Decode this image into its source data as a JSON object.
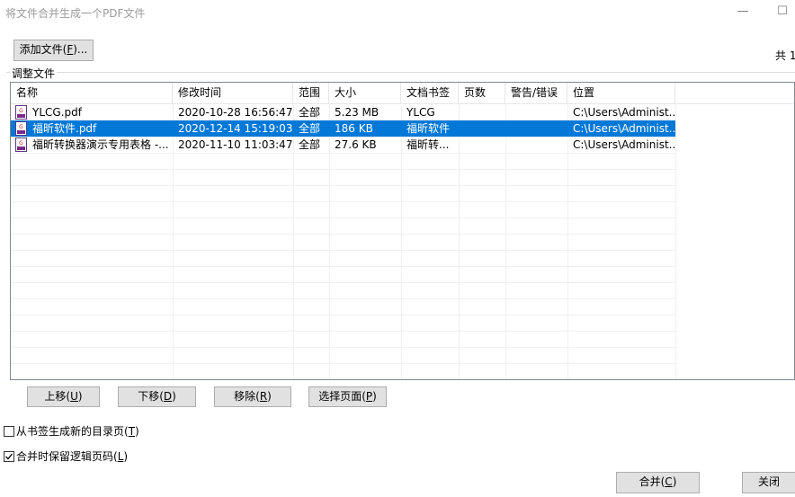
{
  "window": {
    "title": "将文件合并生成一个PDF文件",
    "minimize_glyph": "—",
    "maximize_glyph": "☐"
  },
  "toolbar": {
    "add_files_label": "添加文件(",
    "add_files_key": "F",
    "add_files_tail": ")...",
    "total_label": "共 1"
  },
  "group": {
    "label": "调整文件"
  },
  "table": {
    "columns": [
      "名称",
      "修改时间",
      "范围",
      "大小",
      "文档书签",
      "页数",
      "警告/错误",
      "位置"
    ],
    "rows": [
      {
        "name": "YLCG.pdf",
        "modified": "2020-10-28 16:56:47",
        "range": "全部",
        "size": "5.23 MB",
        "bookmark": "YLCG",
        "pages": "",
        "warning": "",
        "location": "C:\\Users\\Administ...",
        "selected": false
      },
      {
        "name": "福昕软件.pdf",
        "modified": "2020-12-14 15:19:03",
        "range": "全部",
        "size": "186 KB",
        "bookmark": "福昕软件",
        "pages": "",
        "warning": "",
        "location": "C:\\Users\\Administ...",
        "selected": true
      },
      {
        "name": "福昕转换器演示专用表格 -...",
        "modified": "2020-11-10 11:03:47",
        "range": "全部",
        "size": "27.6 KB",
        "bookmark": "福昕转...",
        "pages": "",
        "warning": "",
        "location": "C:\\Users\\Administ...",
        "selected": false
      }
    ],
    "file_icon": "pdf-file-icon",
    "selection_color": "#0078d7"
  },
  "actions": {
    "move_up": {
      "label": "上移(",
      "key": "U",
      "tail": ")"
    },
    "move_down": {
      "label": "下移(",
      "key": "D",
      "tail": ")"
    },
    "remove": {
      "label": "移除(",
      "key": "R",
      "tail": ")"
    },
    "select_pages": {
      "label": "选择页面(",
      "key": "P",
      "tail": ")"
    }
  },
  "options": {
    "toc_from_bookmarks": {
      "label": "从书签生成新的目录页(",
      "key": "T",
      "tail": ")",
      "checked": false
    },
    "keep_logical_page_numbers": {
      "label": "合并时保留逻辑页码(",
      "key": "L",
      "tail": ")",
      "checked": true
    }
  },
  "footer": {
    "merge": {
      "label": "合并(",
      "key": "C",
      "tail": ")"
    },
    "close": {
      "label": "关闭"
    }
  }
}
